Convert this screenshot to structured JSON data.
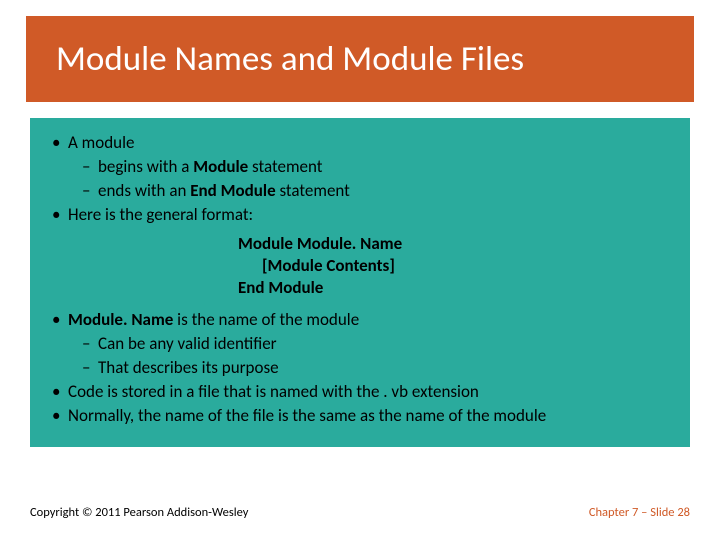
{
  "header": {
    "title": "Module Names and Module Files"
  },
  "content": {
    "top": {
      "b1": "A module",
      "b1_d1_pre": "begins with a ",
      "b1_d1_bold": "Module",
      "b1_d1_post": " statement",
      "b1_d2_pre": "ends with an ",
      "b1_d2_bold": "End Module",
      "b1_d2_post": " statement",
      "b2": "Here is the general format:"
    },
    "code": {
      "l1": "Module Module. Name",
      "l2": "[Module Contents]",
      "l3": "End Module"
    },
    "bottom": {
      "b1_bold": "Module. Name",
      "b1_post": " is the name of the module",
      "b1_d1": "Can be any valid identifier",
      "b1_d2": "That describes its purpose",
      "b2": "Code is stored in a file that is named with the . vb extension",
      "b3": "Normally, the name of the file is the same as the name of the module"
    }
  },
  "footer": {
    "copyright": "Copyright © 2011 Pearson Addison-Wesley",
    "chapter": "Chapter 7 – Slide 28"
  }
}
